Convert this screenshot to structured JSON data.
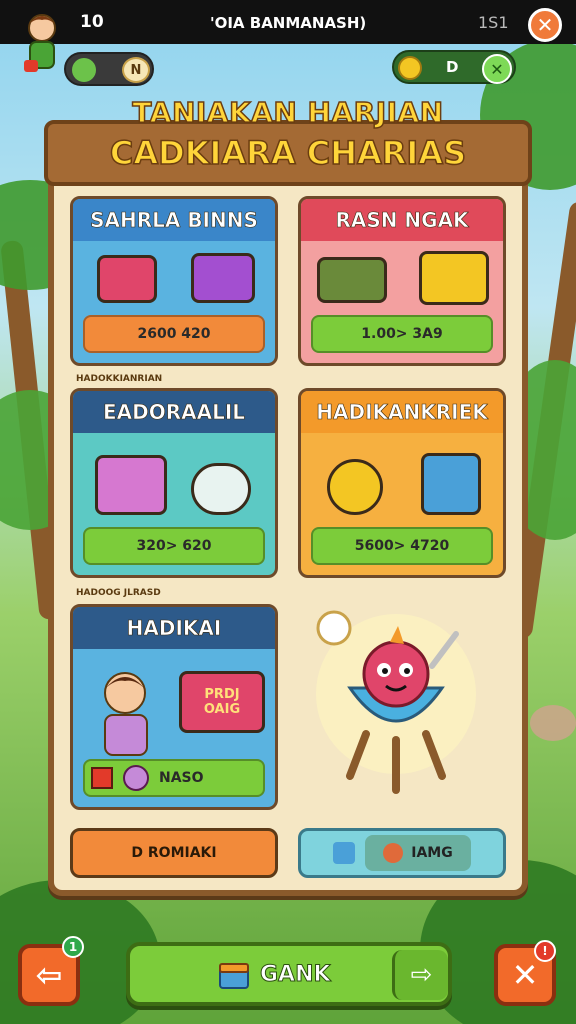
{
  "topbar": {
    "left_number": "10",
    "title": "'OIA BANMANASH)",
    "right_number": "1S1"
  },
  "hud": {
    "coin_label": "N",
    "currency_value": "D"
  },
  "header": {
    "line1": "TANIAKAN HARJIAN",
    "line2": "CADKIARA CHARIAS"
  },
  "cards": [
    {
      "title": "SAHRLA BINNS",
      "button": "2600 420"
    },
    {
      "title": "RASN NGAK",
      "button": "1.00> 3A9"
    },
    {
      "title": "EADORAALIL",
      "button": "320> 620",
      "tag": "HADOKKIANRIAN"
    },
    {
      "title": "HADIKANKRIEK",
      "button": "5600> 4720"
    },
    {
      "title": "HADIKAI",
      "button": "NASO",
      "tag": "HADOOG JLRASD",
      "chest_text_1": "PRDJ",
      "chest_text_2": "OAIG"
    }
  ],
  "bottom_buttons": {
    "left": "D ROMIAKI",
    "right": "IAMG"
  },
  "footer": {
    "main_label": "GANK",
    "left_badge": "1",
    "right_badge": "!"
  },
  "colors": {
    "board_bg": "#f5e7c4",
    "wood": "#8a5a2b",
    "title_gold": "#ffd53a",
    "green_button": "#7ccc3a",
    "orange_button": "#f26a2a"
  }
}
